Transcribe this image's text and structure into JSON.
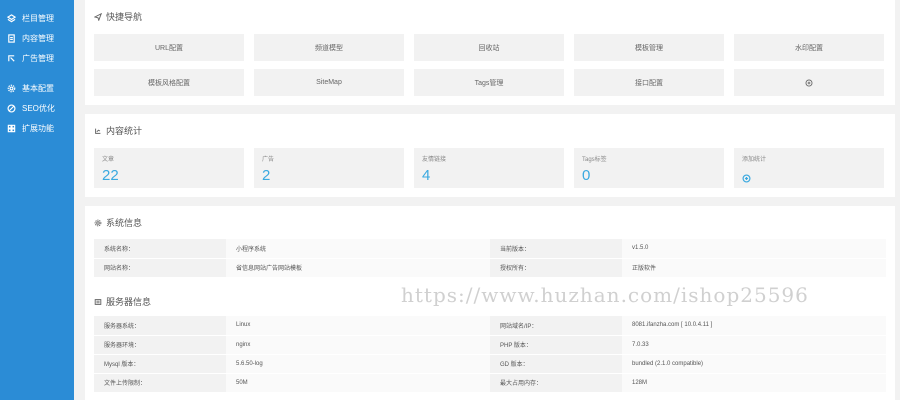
{
  "sidebar": {
    "items": [
      {
        "label": "栏目管理",
        "icon": "layers-icon"
      },
      {
        "label": "内容管理",
        "icon": "document-icon"
      },
      {
        "label": "广告管理",
        "icon": "ad-icon"
      },
      {
        "label": "基本配置",
        "icon": "gear-icon"
      },
      {
        "label": "SEO优化",
        "icon": "globe-icon"
      },
      {
        "label": "扩展功能",
        "icon": "grid-icon"
      }
    ]
  },
  "quick_nav": {
    "title": "快捷导航",
    "buttons": [
      "URL配置",
      "频道模型",
      "回收站",
      "模板管理",
      "水印配置",
      "模板风格配置",
      "SiteMap",
      "Tags管理",
      "接口配置"
    ]
  },
  "stats": {
    "title": "内容统计",
    "items": [
      {
        "label": "文章",
        "value": "22"
      },
      {
        "label": "广告",
        "value": "2"
      },
      {
        "label": "友情链接",
        "value": "4"
      },
      {
        "label": "Tags标签",
        "value": "0"
      },
      {
        "label": "添加统计"
      }
    ]
  },
  "system_info": {
    "title": "系统信息",
    "rows": [
      {
        "k1": "系统名称：",
        "v1": "小程序系统",
        "k2": "当前版本：",
        "v2": "v1.5.0"
      },
      {
        "k1": "网站名称：",
        "v1": "省信息网站广告网站模板",
        "k2": "授权所有：",
        "v2": "正版软件"
      }
    ]
  },
  "server_info": {
    "title": "服务器信息",
    "rows": [
      {
        "k1": "服务器系统：",
        "v1": "Linux",
        "k2": "网站域名/IP：",
        "v2": "8081.ifanzha.com [ 10.0.4.11 ]"
      },
      {
        "k1": "服务器环境：",
        "v1": "nginx",
        "k2": "PHP 版本：",
        "v2": "7.0.33"
      },
      {
        "k1": "Mysql 版本：",
        "v1": "5.6.50-log",
        "k2": "GD 版本：",
        "v2": "bundled (2.1.0 compatible)"
      },
      {
        "k1": "文件上传限制：",
        "v1": "50M",
        "k2": "最大占用内存：",
        "v2": "128M"
      }
    ]
  },
  "watermark": "https://www.huzhan.com/ishop25596",
  "colors": {
    "sidebar": "#2b8cd6",
    "accent": "#3aa9e0",
    "background": "#f2f2f2"
  }
}
